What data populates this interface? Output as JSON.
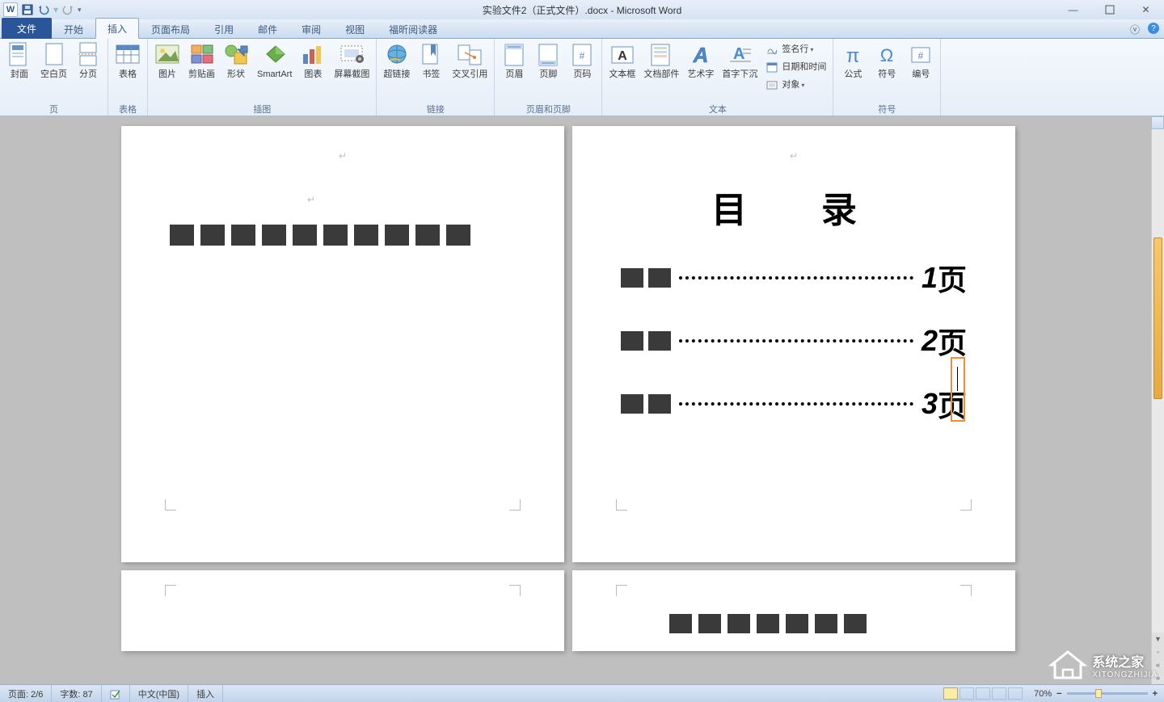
{
  "app": {
    "title": "实验文件2（正式文件）.docx - Microsoft Word",
    "logo_char": "W"
  },
  "qat": {
    "save": "save",
    "undo": "undo",
    "redo": "redo"
  },
  "window_controls": {
    "min": "—",
    "max": "▢",
    "close": "✕"
  },
  "tabs": {
    "file": "文件",
    "home": "开始",
    "insert": "插入",
    "layout": "页面布局",
    "references": "引用",
    "mailings": "邮件",
    "review": "审阅",
    "view": "视图",
    "foxit": "福昕阅读器",
    "help_collapse": "ⓥ",
    "help": "?"
  },
  "ribbon": {
    "groups": {
      "pages": {
        "label": "页",
        "items": {
          "cover": "封面",
          "blank": "空白页",
          "break": "分页"
        }
      },
      "tables": {
        "label": "表格",
        "items": {
          "table": "表格"
        }
      },
      "illustrations": {
        "label": "插图",
        "items": {
          "picture": "图片",
          "clipart": "剪贴画",
          "shapes": "形状",
          "smartart": "SmartArt",
          "chart": "图表",
          "screenshot": "屏幕截图"
        }
      },
      "links": {
        "label": "链接",
        "items": {
          "hyperlink": "超链接",
          "bookmark": "书签",
          "crossref": "交叉引用"
        }
      },
      "headerfooter": {
        "label": "页眉和页脚",
        "items": {
          "header": "页眉",
          "footer": "页脚",
          "pagenum": "页码"
        }
      },
      "text": {
        "label": "文本",
        "items": {
          "textbox": "文本框",
          "quickparts": "文档部件",
          "wordart": "艺术字",
          "dropcap": "首字下沉",
          "signature": "签名行",
          "datetime": "日期和时间",
          "object": "对象"
        }
      },
      "symbols": {
        "label": "符号",
        "items": {
          "equation": "公式",
          "symbol": "符号",
          "number": "编号"
        }
      }
    }
  },
  "document": {
    "page2": {
      "toc_title": "目　录",
      "rows": [
        {
          "label": "■■",
          "page": "1",
          "suffix": "页"
        },
        {
          "label": "■■",
          "page": "2",
          "suffix": "页"
        },
        {
          "label": "■■",
          "page": "3",
          "suffix": "页"
        }
      ]
    }
  },
  "statusbar": {
    "page": "页面: 2/6",
    "words": "字数: 87",
    "lang": "中文(中国)",
    "mode": "插入",
    "zoom": "70%"
  },
  "watermark": {
    "brand": "系统之家",
    "sub": "XITONGZHIJIA"
  }
}
